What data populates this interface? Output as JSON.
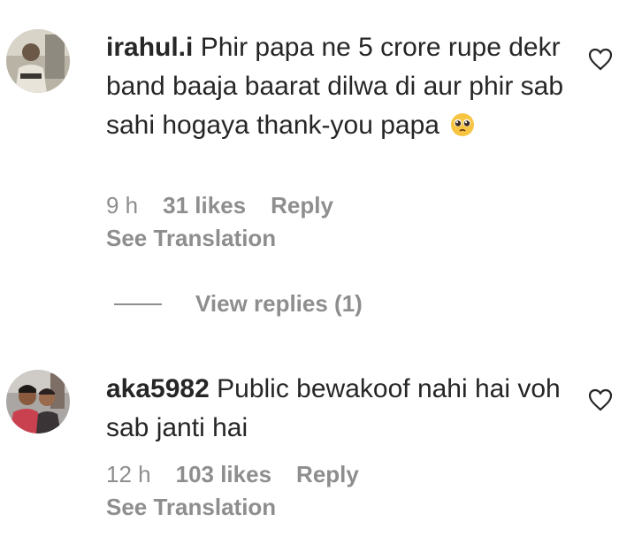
{
  "comments": [
    {
      "username": "irahul.i",
      "text": "Phir papa ne 5 crore rupe dekr band baaja baarat dilwa di aur phir sab sahi hogaya thank-you papa",
      "emoji": "pleading-face",
      "time": "9 h",
      "likes": "31 likes",
      "reply_label": "Reply",
      "translation_label": "See Translation"
    },
    {
      "username": "aka5982",
      "text": "Public bewakoof nahi hai voh sab janti hai",
      "time": "12 h",
      "likes": "103 likes",
      "reply_label": "Reply",
      "translation_label": "See Translation"
    }
  ],
  "view_replies": {
    "label": "View replies (1)"
  },
  "colors": {
    "text": "#262626",
    "secondary": "#8e8e8e",
    "background": "#ffffff"
  }
}
